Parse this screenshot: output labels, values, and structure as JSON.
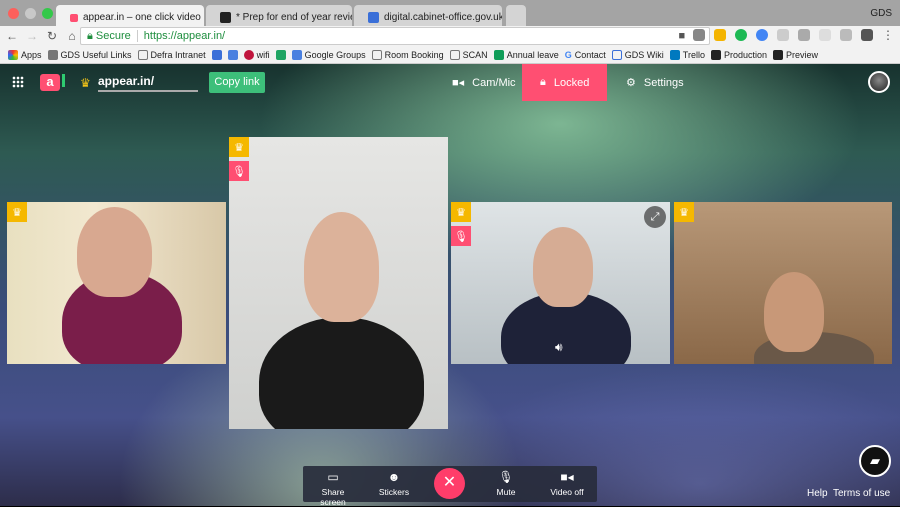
{
  "browser": {
    "tabs": [
      {
        "title": "appear.in – one click video c",
        "active": true
      },
      {
        "title": "* Prep for end of year review o",
        "active": false
      },
      {
        "title": "digital.cabinet-office.gov.uk -",
        "active": false
      }
    ],
    "profile": "GDS",
    "secure_label": "Secure",
    "url": "https://appear.in/",
    "bookmarks": [
      "Apps",
      "GDS Useful Links",
      "Defra Intranet",
      "wifi",
      "Google Groups",
      "Room Booking",
      "SCAN",
      "Annual leave",
      "Contact",
      "GDS Wiki",
      "Trello",
      "Production",
      "Preview"
    ]
  },
  "app": {
    "logo_letter": "a",
    "room_name": "appear.in/",
    "copy_link": "Copy link",
    "cam_mic": "Cam/Mic",
    "locked": "Locked",
    "settings": "Settings",
    "accent": "#ff4f72",
    "participants": [
      {
        "owner": true,
        "muted": false
      },
      {
        "owner": true,
        "muted": true
      },
      {
        "owner": true,
        "muted": true,
        "speaking": true
      },
      {
        "owner": true,
        "muted": false
      }
    ],
    "controls": {
      "share_screen": "Share screen",
      "stickers": "Stickers",
      "mute": "Mute",
      "video_off": "Video off"
    },
    "help": "Help",
    "terms": "Terms of use"
  }
}
